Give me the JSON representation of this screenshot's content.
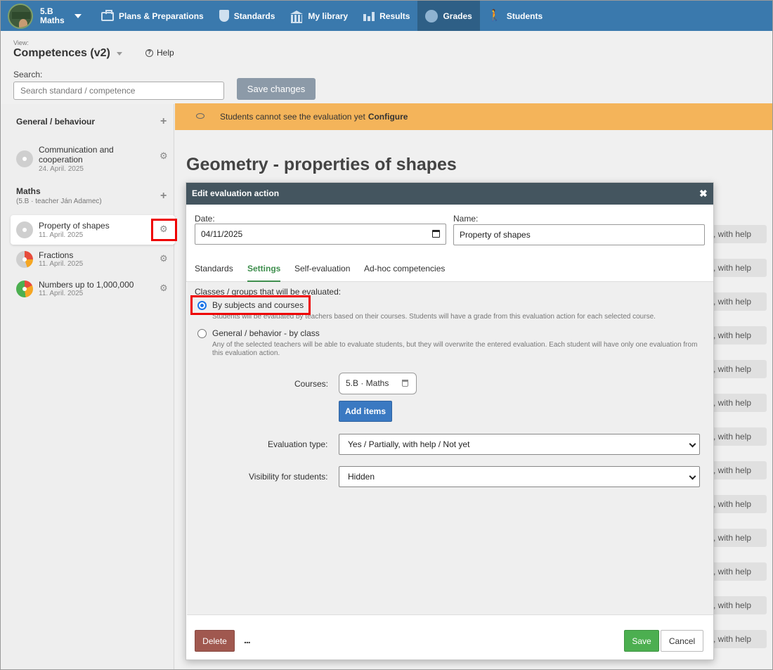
{
  "nav": {
    "class_line1": "5.B",
    "class_line2": "Maths",
    "items": [
      {
        "label": "Plans & Preparations",
        "icon": "briefcase-icon"
      },
      {
        "label": "Standards",
        "icon": "shield-icon"
      },
      {
        "label": "My library",
        "icon": "library-icon"
      },
      {
        "label": "Results",
        "icon": "bar-chart-icon"
      },
      {
        "label": "Grades",
        "icon": "grades-icon",
        "active": true
      },
      {
        "label": "Students",
        "icon": "students-icon"
      }
    ]
  },
  "header": {
    "view_label": "View:",
    "view_title": "Competences (v2)",
    "help": "Help",
    "search_label": "Search:",
    "search_placeholder": "Search standard / competence",
    "save_changes": "Save changes"
  },
  "sidebar": {
    "general_title": "General / behaviour",
    "maths_title": "Maths",
    "maths_sub": "(5.B · teacher Ján Adamec)",
    "items": [
      {
        "title": "Communication and cooperation",
        "date": "24. April. 2025"
      },
      {
        "title": "Property of shapes",
        "date": "11. April. 2025"
      },
      {
        "title": "Fractions",
        "date": "11. April. 2025"
      },
      {
        "title": "Numbers up to 1,000,000",
        "date": "11. April. 2025"
      }
    ]
  },
  "main": {
    "banner_text": "Students cannot see the evaluation yet",
    "banner_link": "Configure",
    "page_title": "Geometry - properties of shapes",
    "bg_pill_text": ", with help"
  },
  "modal": {
    "title": "Edit evaluation action",
    "date_label": "Date:",
    "date_value": "04/11/2025",
    "name_label": "Name:",
    "name_value": "Property of shapes",
    "tabs": [
      "Standards",
      "Settings",
      "Self-evaluation",
      "Ad-hoc competencies"
    ],
    "classes_label": "Classes / groups that will be evaluated:",
    "option1_label": "By subjects and courses",
    "option1_help": "Students will be evaluated by teachers based on their courses. Students will have a grade from this evaluation action for each selected course.",
    "option2_label": "General / behavior - by class",
    "option2_help": "Any of the selected teachers will be able to evaluate students, but they will overwrite the entered evaluation. Each student will have only one evaluation from this evaluation action.",
    "courses_label": "Courses:",
    "course_chip": "5.B · Maths",
    "add_items": "Add items",
    "eval_type_label": "Evaluation type:",
    "eval_type_value": "Yes / Partially, with help / Not yet",
    "visibility_label": "Visibility for students:",
    "visibility_value": "Hidden",
    "delete": "Delete",
    "more": "...",
    "save": "Save",
    "cancel": "Cancel"
  },
  "colors": {
    "nav_bg": "#3a79ad",
    "banner": "#f4b45a",
    "accent_green": "#3e8e4d",
    "highlight_red": "#e00000"
  }
}
